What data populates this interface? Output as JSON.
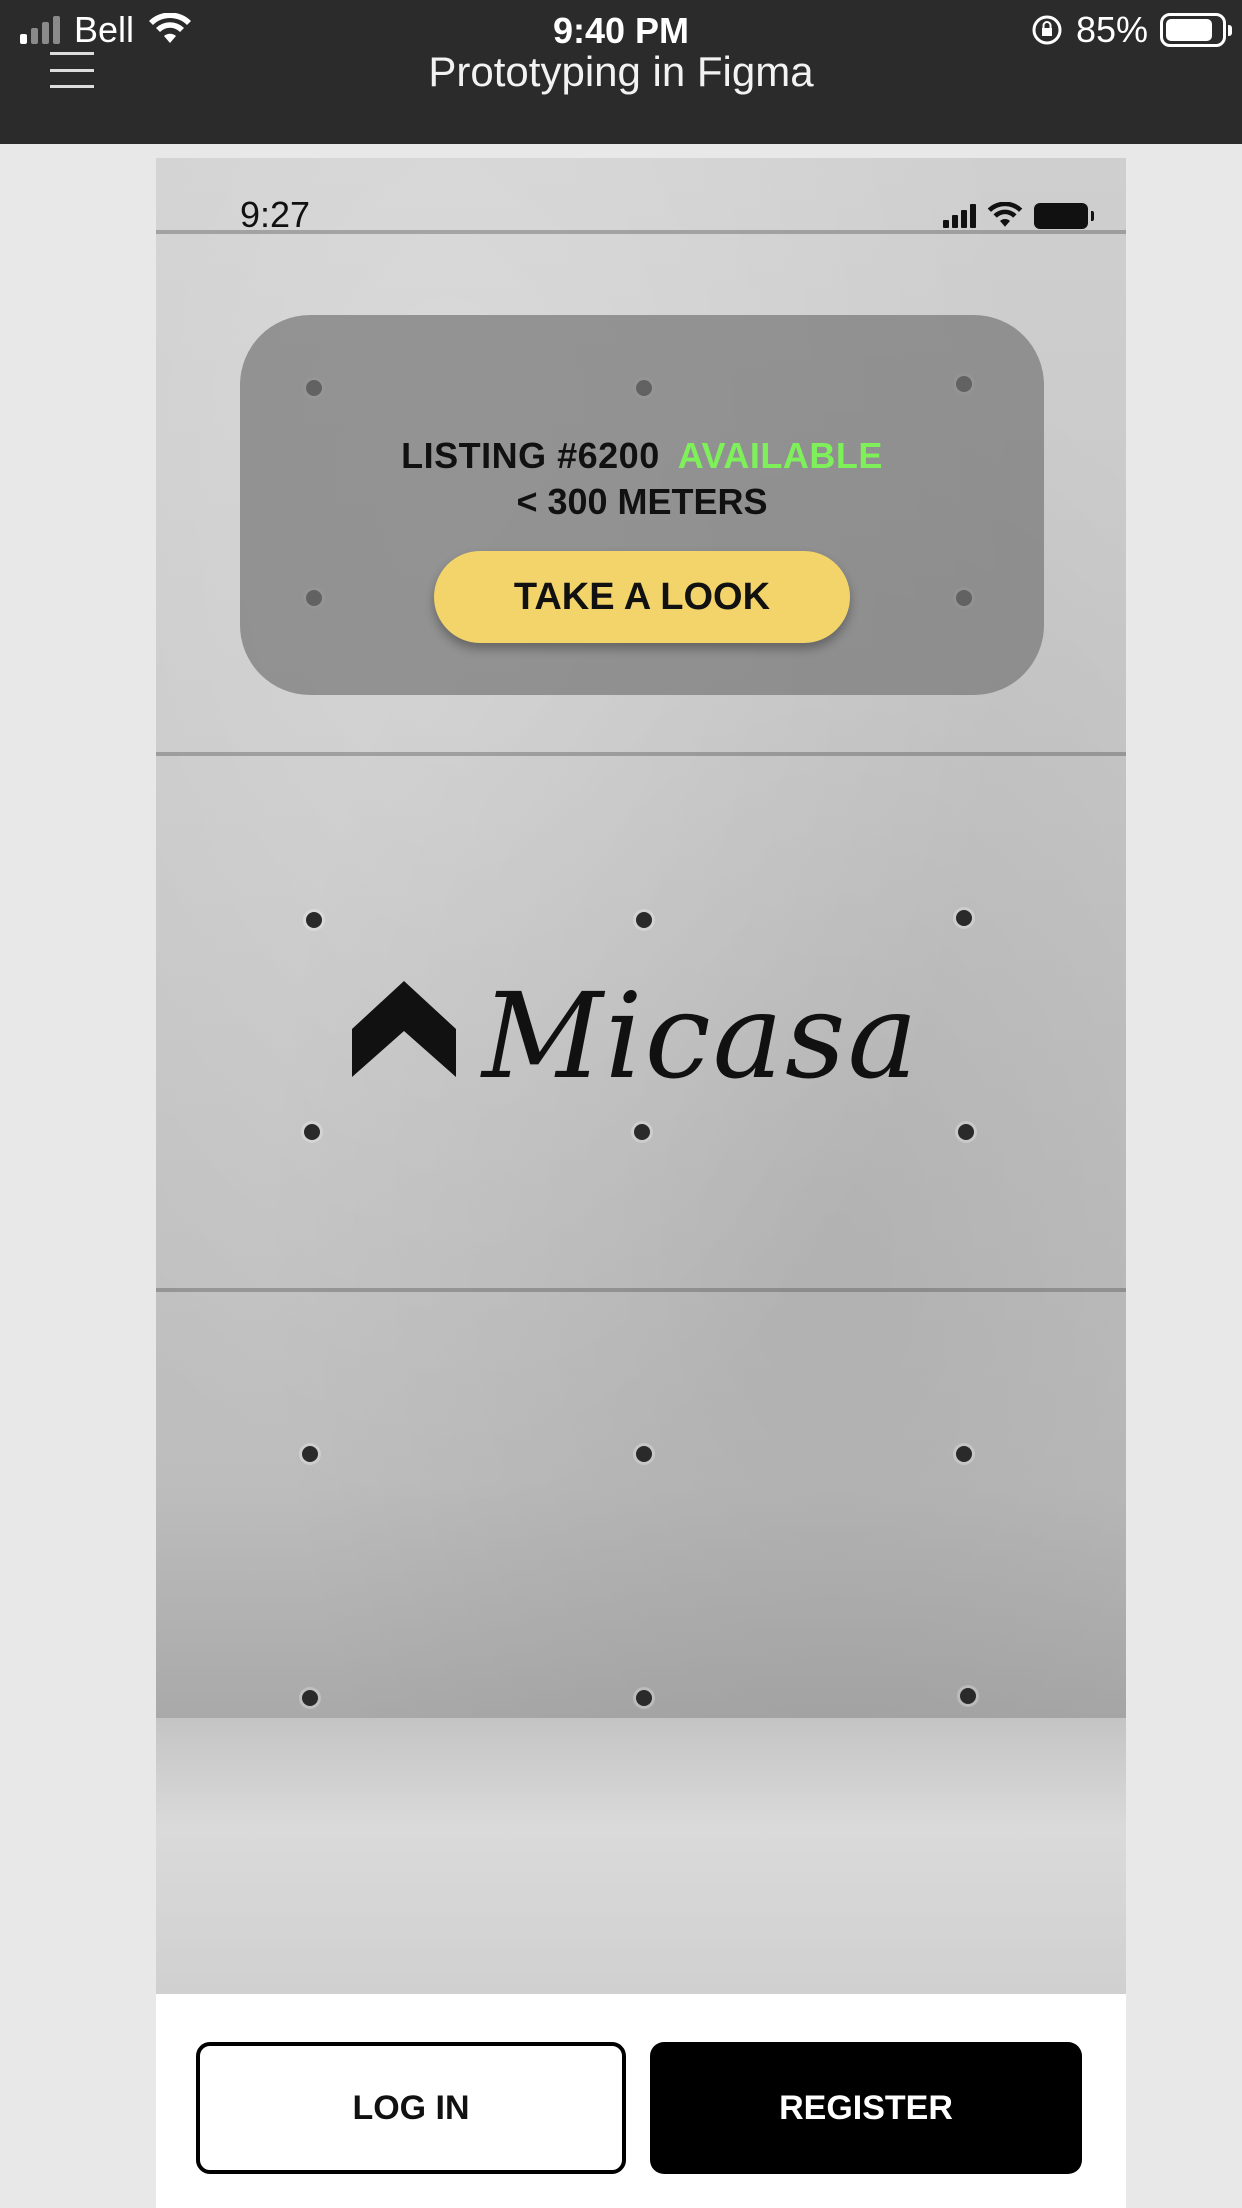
{
  "device_status": {
    "carrier": "Bell",
    "time": "9:40 PM",
    "battery": "85%",
    "battery_level": 0.85
  },
  "app_bar": {
    "title": "Prototyping in Figma",
    "menu_icon": "hamburger-menu-icon"
  },
  "prototype": {
    "status_time": "9:27",
    "listing": {
      "label": "LISTING #6200",
      "status": "AVAILABLE",
      "status_color": "#7ef05a",
      "distance": "< 300 METERS",
      "cta": "TAKE A LOOK",
      "cta_color": "#f2d46b"
    },
    "logo": {
      "name": "Micasa",
      "icon": "house-chevron-icon"
    },
    "actions": {
      "login": "LOG IN",
      "register": "REGISTER"
    }
  }
}
